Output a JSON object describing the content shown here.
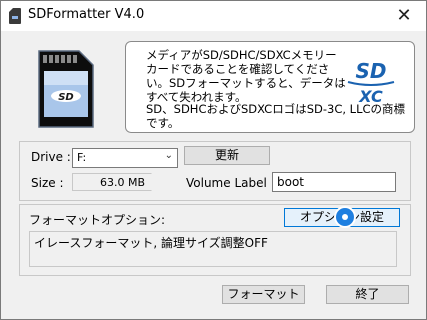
{
  "window": {
    "title": "SDFormatter V4.0",
    "close_glyph": "✕"
  },
  "info": {
    "message": "メディアがSD/SDHC/SDXCメモリーカードであることを確認してください。SDフォーマットすると、データはすべて失われます。",
    "trademark": "SD、SDHCおよびSDXCロゴはSD-3C, LLCの商標です。",
    "logo_top": "SD",
    "logo_bottom": "XC"
  },
  "card": {
    "label": "SD"
  },
  "drive": {
    "label": "Drive :",
    "value": "F:",
    "refresh_label": "更新"
  },
  "size": {
    "label": "Size :",
    "value": "63.0 MB"
  },
  "volume": {
    "label": "Volume Label :",
    "value": "boot"
  },
  "options": {
    "label": "フォーマットオプション:",
    "button_label": "オプション設定",
    "value": "イレースフォーマット, 論理サイズ調整OFF"
  },
  "actions": {
    "format_label": "フォーマット",
    "exit_label": "終了"
  },
  "colors": {
    "accent": "#0078d7",
    "cursor": "#1e7fe0",
    "sd_logo": "#1a62b0"
  }
}
